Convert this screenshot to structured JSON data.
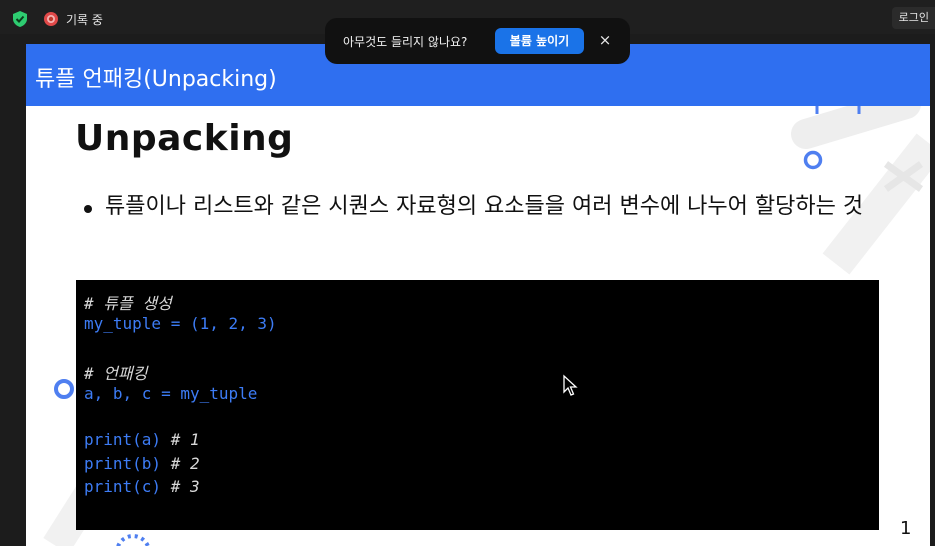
{
  "topbar": {
    "recording_label": "기록 중",
    "login_label": "로그인"
  },
  "toast": {
    "message": "아무것도 들리지 않나요?",
    "button_label": "볼륨 높이기",
    "close_label": "×"
  },
  "slide": {
    "header_title": "튜플 언패킹(Unpacking)",
    "title": "Unpacking",
    "bullet": "튜플이나 리스트와 같은 시퀀스 자료형의 요소들을 여러 변수에 나누어 할당하는 것",
    "page_number": "1",
    "code": {
      "line1": "# 튜플 생성",
      "line2": "my_tuple = (1, 2, 3)",
      "line4": "# 언패킹",
      "line5": "a, b, c = my_tuple",
      "line7_code": "print(a)",
      "line7_comment": " # 1",
      "line8_code": "print(b)",
      "line8_comment": " # 2",
      "line9_code": "print(c)",
      "line9_comment": " # 3"
    }
  },
  "colors": {
    "header_blue": "#2f6ff0",
    "code_keyword": "#3d7cf5",
    "toast_button": "#1a73e8",
    "shield_green": "#2ecc71"
  },
  "icons": [
    "shield-check-icon",
    "record-icon",
    "mouse-cursor-icon",
    "close-icon"
  ]
}
